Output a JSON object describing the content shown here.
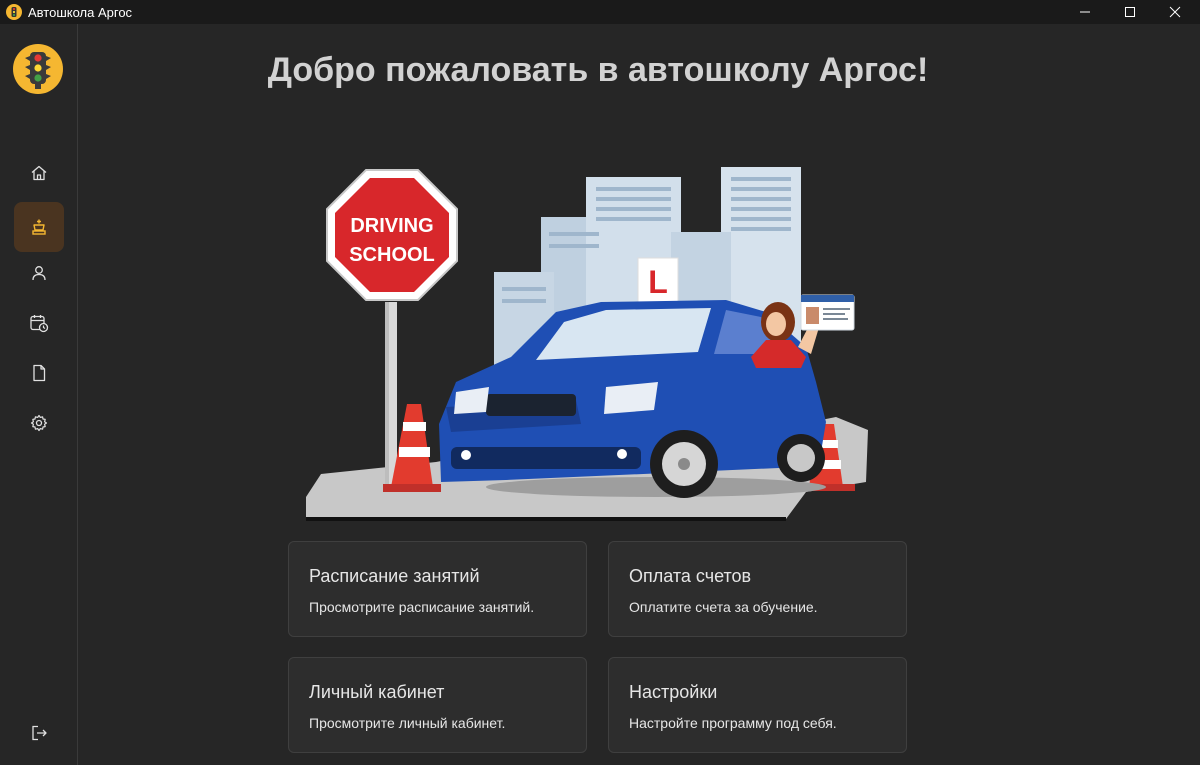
{
  "window": {
    "title": "Автошкола Аргос"
  },
  "sidebar": {
    "items": [
      {
        "icon": "home-icon",
        "active": false
      },
      {
        "icon": "chess-king-icon",
        "active": true
      },
      {
        "icon": "user-icon",
        "active": false
      },
      {
        "icon": "calendar-clock-icon",
        "active": false
      },
      {
        "icon": "document-icon",
        "active": false
      },
      {
        "icon": "gear-icon",
        "active": false
      }
    ],
    "logout_icon": "logout-icon"
  },
  "main": {
    "heading": "Добро пожаловать в автошколу Аргос!",
    "illustration": {
      "sign_line1": "DRIVING",
      "sign_line2": "SCHOOL",
      "learner_plate": "L"
    },
    "cards": [
      {
        "title": "Расписание занятий",
        "description": "Просмотрите расписание занятий."
      },
      {
        "title": "Оплата счетов",
        "description": "Оплатите счета за обучение."
      },
      {
        "title": "Личный кабинет",
        "description": "Просмотрите личный кабинет."
      },
      {
        "title": "Настройки",
        "description": "Настройте программу под себя."
      }
    ]
  },
  "colors": {
    "background": "#262626",
    "accent": "#f5b731",
    "active_nav": "#4a3420",
    "card": "#2d2d2d",
    "car": "#1f4fb4",
    "sign_red": "#d8272b"
  }
}
